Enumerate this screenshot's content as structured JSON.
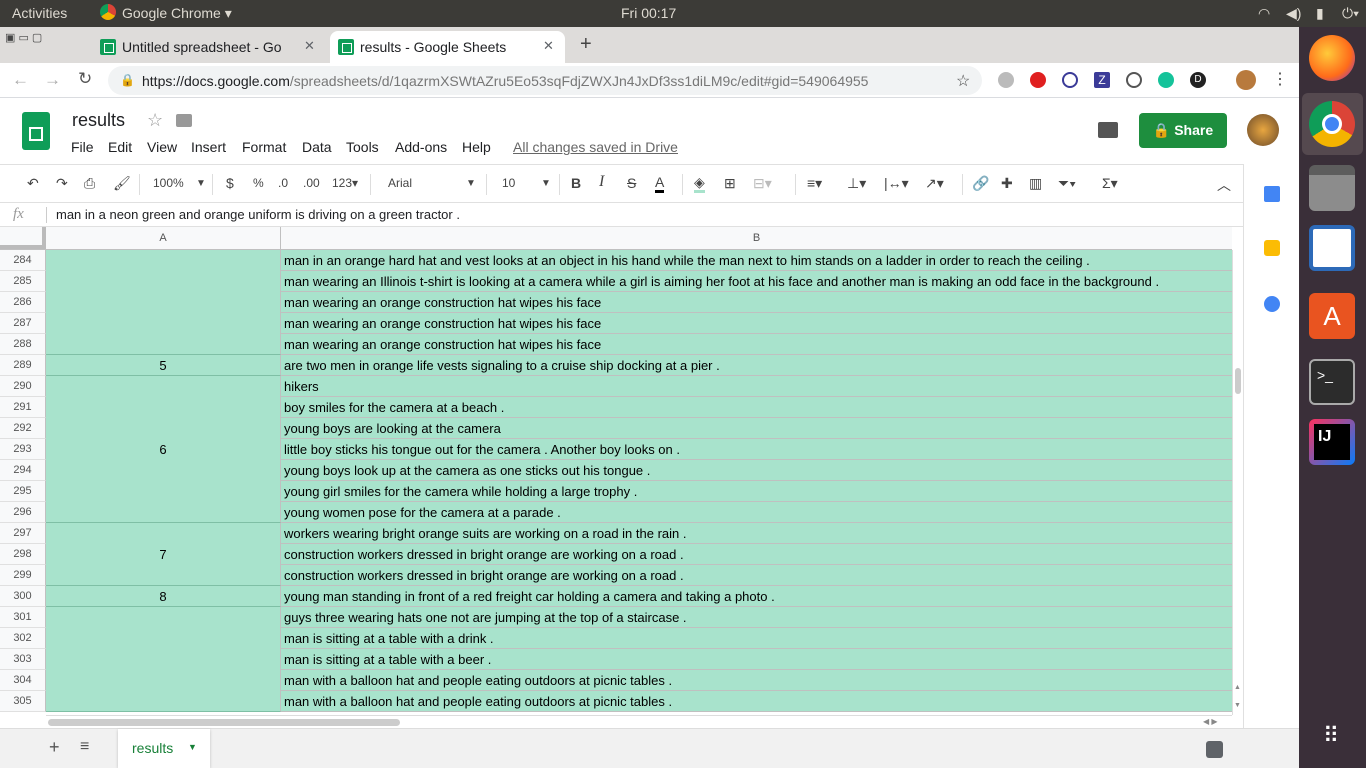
{
  "os": {
    "activities": "Activities",
    "app_menu": "Google Chrome",
    "clock": "Fri 00:17"
  },
  "browser": {
    "tabs": [
      {
        "label": "Untitled spreadsheet - Go"
      },
      {
        "label": "results - Google Sheets"
      }
    ],
    "url_host": "https://docs.google.com",
    "url_path": "/spreadsheets/d/1qazrmXSWtAZru5Eo53sqFdjZWXJn4JxDf3ss1diLM9c/edit#gid=549064955",
    "ext_letters": [
      "Z",
      "D"
    ]
  },
  "doc": {
    "title": "results",
    "menus": [
      "File",
      "Edit",
      "View",
      "Insert",
      "Format",
      "Data",
      "Tools",
      "Add-ons",
      "Help"
    ],
    "save_status": "All changes saved in Drive",
    "share_label": "Share"
  },
  "toolbar": {
    "zoom": "100%",
    "currency": "$",
    "percent": "%",
    "dec_less": ".0",
    "dec_more": ".00",
    "num_format": "123",
    "font": "Arial",
    "font_size": "10"
  },
  "formula": {
    "fx": "fx",
    "value": "man in a neon green and orange uniform is driving on a green tractor ."
  },
  "columns": [
    "A",
    "B"
  ],
  "rows": [
    {
      "n": "284",
      "b": "man in an orange hard hat and vest looks at an object in his hand while the man next to him stands on a ladder in order to reach the ceiling ."
    },
    {
      "n": "285",
      "b": "man wearing an Illinois t-shirt is looking at a camera while a girl is aiming her foot at his face and another man is making an odd face in the background ."
    },
    {
      "n": "286",
      "b": "man wearing an orange construction hat wipes his face"
    },
    {
      "n": "287",
      "b": "man wearing an orange construction hat wipes his face"
    },
    {
      "n": "288",
      "b": "man wearing an orange construction hat wipes his face"
    },
    {
      "n": "289",
      "b": "are two men in orange life vests signaling to a cruise ship docking at a pier ."
    },
    {
      "n": "290",
      "b": "hikers"
    },
    {
      "n": "291",
      "b": "boy smiles for the camera at a beach ."
    },
    {
      "n": "292",
      "b": "young boys are looking at the camera"
    },
    {
      "n": "293",
      "b": "little boy sticks his tongue out for the camera . Another boy looks on ."
    },
    {
      "n": "294",
      "b": "young boys look up at the camera as one sticks out his tongue ."
    },
    {
      "n": "295",
      "b": "young girl smiles for the camera while holding a large trophy ."
    },
    {
      "n": "296",
      "b": "young women pose for the camera at a parade ."
    },
    {
      "n": "297",
      "b": "workers wearing bright orange suits are working on a road in the rain ."
    },
    {
      "n": "298",
      "b": "construction workers dressed in bright orange are working on a road ."
    },
    {
      "n": "299",
      "b": "construction workers dressed in bright orange are working on a road ."
    },
    {
      "n": "300",
      "b": "young man standing in front of a red freight car holding a camera and taking a photo ."
    },
    {
      "n": "301",
      "b": "guys three wearing hats one not are jumping at the top of a staircase ."
    },
    {
      "n": "302",
      "b": "man is sitting at a table with a drink ."
    },
    {
      "n": "303",
      "b": "man is sitting at a table with a beer ."
    },
    {
      "n": "304",
      "b": "man with a balloon hat and people eating outdoors at picnic tables ."
    },
    {
      "n": "305",
      "b": "man with a balloon hat and people eating outdoors at picnic tables ."
    }
  ],
  "merged_a": [
    {
      "label": "",
      "from": 0,
      "to": 4
    },
    {
      "label": "5",
      "from": 5,
      "to": 5
    },
    {
      "label": "6",
      "from": 6,
      "to": 12
    },
    {
      "label": "7",
      "from": 13,
      "to": 15
    },
    {
      "label": "8",
      "from": 16,
      "to": 16
    },
    {
      "label": "",
      "from": 17,
      "to": 21
    }
  ],
  "sheet_tab": "results",
  "colors": {
    "cell_fill": "#a8e3cc",
    "sheets_green": "#0f9d58",
    "share_bg": "#1e8e3e",
    "dock_bg": "#3a2f39"
  }
}
